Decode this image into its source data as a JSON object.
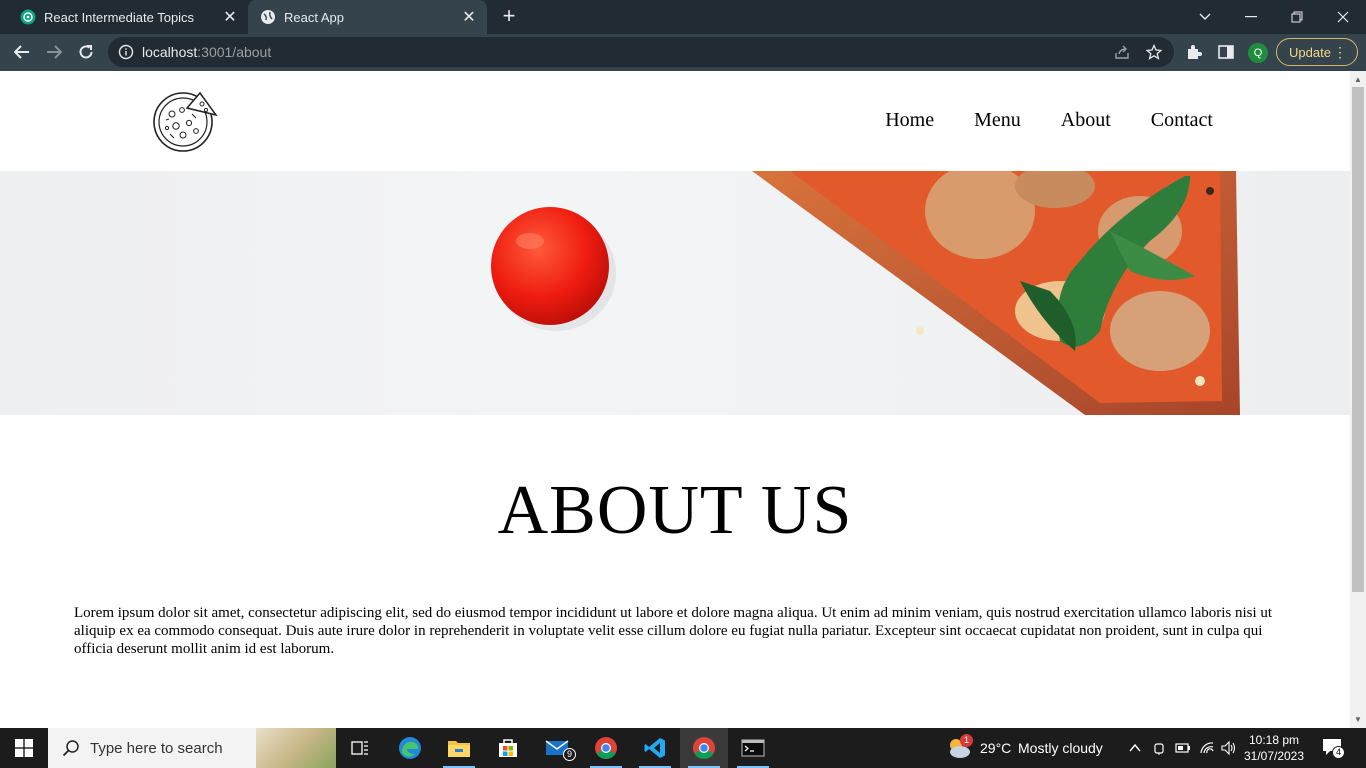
{
  "browser": {
    "tabs": [
      {
        "title": "React Intermediate Topics",
        "active": false
      },
      {
        "title": "React App",
        "active": true
      }
    ],
    "url_host": "localhost",
    "url_rest": ":3001/about",
    "update_label": "Update",
    "profile_initial": "Q"
  },
  "page": {
    "nav": {
      "home": "Home",
      "menu": "Menu",
      "about": "About",
      "contact": "Contact"
    },
    "heading": "ABOUT US",
    "body": "Lorem ipsum dolor sit amet, consectetur adipiscing elit, sed do eiusmod tempor incididunt ut labore et dolore magna aliqua. Ut enim ad minim veniam, quis nostrud exercitation ullamco laboris nisi ut aliquip ex ea commodo consequat. Duis aute irure dolor in reprehenderit in voluptate velit esse cillum dolore eu fugiat nulla pariatur. Excepteur sint occaecat cupidatat non proident, sunt in culpa qui officia deserunt mollit anim id est laborum."
  },
  "taskbar": {
    "search_placeholder": "Type here to search",
    "mail_badge": "9",
    "weather_badge": "1",
    "temperature": "29°C",
    "weather": "Mostly cloudy",
    "time": "10:18 pm",
    "date": "31/07/2023",
    "notification_count": "4"
  },
  "colors": {
    "tab_strip": "#202b33",
    "toolbar": "#35434c",
    "update_border": "#d7b86a",
    "taskbar": "#1c1c1c"
  }
}
